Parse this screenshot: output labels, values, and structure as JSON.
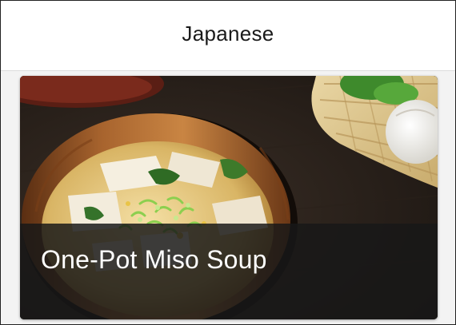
{
  "header": {
    "title": "Japanese"
  },
  "recipe_card": {
    "title": "One-Pot Miso Soup",
    "image": "miso-soup-photo"
  }
}
